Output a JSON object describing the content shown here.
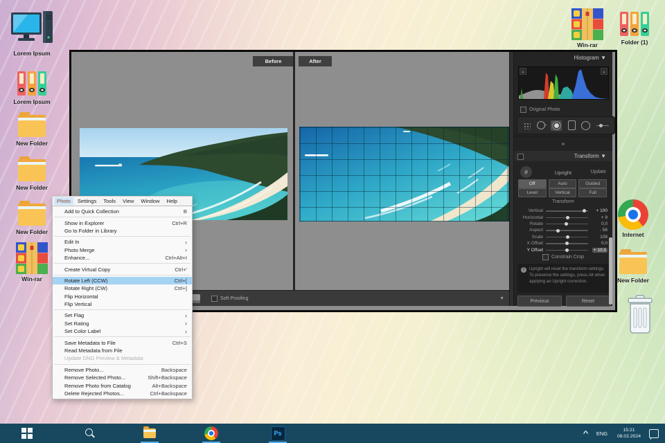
{
  "colors": {
    "taskbar": "#17485f",
    "menu_highlight": "#a5d3f3",
    "taskbar_underline": "#57b1ea",
    "pane_tab_bg": "#3f3f3f",
    "panel_bg": "#242424"
  },
  "desktop": {
    "icon_labels": {
      "computer": "Lorem Ipsum",
      "binders": "Lorem Ipsum",
      "folder_a": "New Folder",
      "folder_b": "New Folder",
      "folder_c": "New Folder",
      "winrar": "Win-rar",
      "winrar_top": "Win-rar",
      "folder_top": "Folder (1)",
      "internet": "Internet",
      "folder_right": "New Folder"
    }
  },
  "editor": {
    "before_label": "Before",
    "after_label": "After",
    "soft_proofing_label": "Soft Proofing",
    "histogram_title": "Histogram",
    "original_photo_label": "Original Photo",
    "transform": {
      "panel_title": "Transform",
      "upright_label": "Upright",
      "update_label": "Update",
      "mode_buttons": [
        "Off",
        "Auto",
        "Guided",
        "Level",
        "Vertical",
        "Full"
      ],
      "section_label": "Transform",
      "sliders": [
        {
          "label": "Vertical",
          "value": "+ 100"
        },
        {
          "label": "Horizontal",
          "value": "+ 9"
        },
        {
          "label": "Rotate",
          "value": "0,0"
        },
        {
          "label": "Aspect",
          "value": "- 56"
        },
        {
          "label": "Scale",
          "value": "108"
        },
        {
          "label": "X Offset",
          "value": "0,0"
        },
        {
          "label": "Y Offset",
          "value": "+ 10,5"
        }
      ],
      "constrain_crop_label": "Constrain Crop",
      "info_text": "Upright will reset the transform settings. To preserve the settings, press Alt when applying an Upright correction.",
      "previous_label": "Previous",
      "reset_label": "Reset"
    }
  },
  "menu": {
    "bar_items": [
      "Photo",
      "Settings",
      "Tools",
      "View",
      "Window",
      "Help"
    ],
    "dropdown_items": [
      {
        "label": "Add to Quick Collection",
        "shortcut": "B"
      },
      {
        "label": "Show in Explorer",
        "shortcut": "Ctrl+R"
      },
      {
        "label": "Go to Folder in Library",
        "shortcut": ""
      },
      {
        "label": "Edit In",
        "shortcut": ""
      },
      {
        "label": "Photo Merge",
        "shortcut": ""
      },
      {
        "label": "Enhance...",
        "shortcut": "Ctrl+Alt+I"
      },
      {
        "label": "Create Virtual Copy",
        "shortcut": "Ctrl+'"
      },
      {
        "label": "Rotate Left (CCW)",
        "shortcut": "Ctrl+["
      },
      {
        "label": "Rotate Right (CW)",
        "shortcut": "Ctrl+]"
      },
      {
        "label": "Flip Horizontal",
        "shortcut": ""
      },
      {
        "label": "Flip Vertical",
        "shortcut": ""
      },
      {
        "label": "Set Flag",
        "shortcut": ""
      },
      {
        "label": "Set Rating",
        "shortcut": ""
      },
      {
        "label": "Set Color Label",
        "shortcut": ""
      },
      {
        "label": "Save Metadata to File",
        "shortcut": "Ctrl+S"
      },
      {
        "label": "Read Metadata from File",
        "shortcut": ""
      },
      {
        "label": "Update DNG Preview & Metadata",
        "shortcut": ""
      },
      {
        "label": "Remove Photo...",
        "shortcut": "Backspace"
      },
      {
        "label": "Remove Selected Photo...",
        "shortcut": "Shift+Backspace"
      },
      {
        "label": "Remove Photo from Catalog",
        "shortcut": "Alt+Backspace"
      },
      {
        "label": "Delete Rejected Photos...",
        "shortcut": "Ctrl+Backspace"
      }
    ]
  },
  "taskbar": {
    "language": "ENG",
    "time": "15:21",
    "date": "08.02.2024"
  }
}
